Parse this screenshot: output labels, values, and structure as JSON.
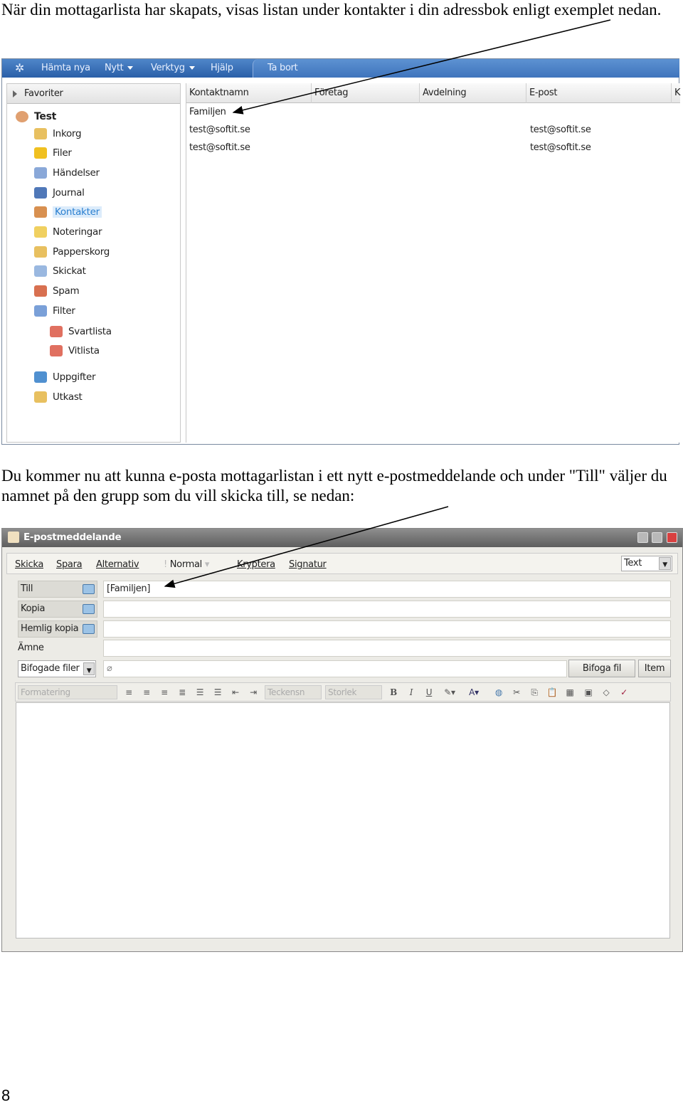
{
  "intro_text": "När din mottagarlista har skapats, visas listan under kontakter i din adressbok enligt exemplet nedan.",
  "addressbook": {
    "toolbar": [
      "Hämta nya",
      "Nytt",
      "Verktyg",
      "Hjälp"
    ],
    "tab": "Ta bort",
    "favorites": "Favoriter",
    "account": "Test",
    "folders": [
      "Inkorg",
      "Filer",
      "Händelser",
      "Journal",
      "Kontakter",
      "Noteringar",
      "Papperskorg",
      "Skickat",
      "Spam",
      "Filter"
    ],
    "filter_children": [
      "Svartlista",
      "Vitlista"
    ],
    "folders_after": [
      "Uppgifter",
      "Utkast"
    ],
    "selected_folder": "Kontakter",
    "columns": [
      "Kontaktnamn",
      "Företag",
      "Avdelning",
      "E-post",
      "K"
    ],
    "rows": [
      {
        "name": "Familjen",
        "company": "",
        "dept": "",
        "email": ""
      },
      {
        "name": "test@softit.se",
        "company": "",
        "dept": "",
        "email": "test@softit.se"
      },
      {
        "name": "test@softit.se",
        "company": "",
        "dept": "",
        "email": "test@softit.se"
      }
    ]
  },
  "mid_text": "Du kommer nu att kunna e-posta mottagarlistan i ett nytt e-postmeddelande och under \"Till\" väljer du namnet på den grupp som du vill skicka till, se nedan:",
  "compose": {
    "title": "E-postmeddelande",
    "toolbar": [
      "Skicka",
      "Spara",
      "Alternativ"
    ],
    "priority": "Normal",
    "toolbar2": [
      "Kryptera",
      "Signatur"
    ],
    "format": "Text",
    "to_label": "Till",
    "to_value": "[Familjen]",
    "cc_label": "Kopia",
    "bcc_label": "Hemlig kopia",
    "subject_label": "Ämne",
    "attachments_label": "Bifogade filer",
    "attach_button": "Bifoga fil",
    "item_button": "Item",
    "formatting": "Formatering",
    "font": "Teckensn",
    "size": "Storlek"
  },
  "page_number": "8"
}
